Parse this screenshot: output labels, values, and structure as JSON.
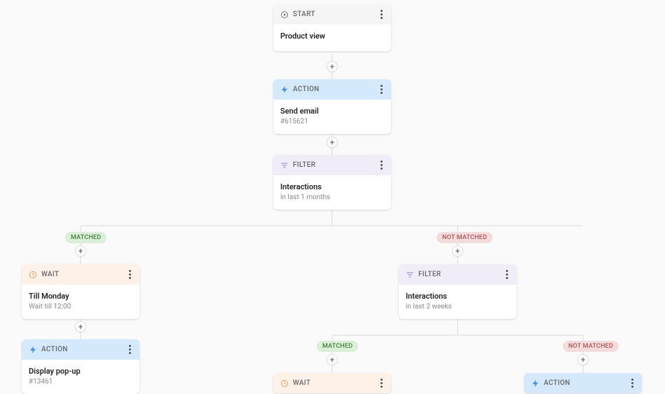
{
  "labels": {
    "start": "START",
    "action": "ACTION",
    "filter": "FILTER",
    "wait": "WAIT",
    "matched": "MATCHED",
    "not_matched": "NOT MATCHED",
    "plus": "+"
  },
  "nodes": {
    "start": {
      "title": "Product view"
    },
    "action1": {
      "title": "Send email",
      "sub": "#615621"
    },
    "filter1": {
      "title": "Interactions",
      "sub": "in last 1 months"
    },
    "wait1": {
      "title": "Till Monday",
      "sub": "Wait till 12:00"
    },
    "action2": {
      "title": "Display pop-up",
      "sub": "#13461"
    },
    "filter2": {
      "title": "Interactions",
      "sub": "in last 2 weeks"
    },
    "wait2": {
      "title": "",
      "sub": ""
    },
    "action3": {
      "title": "",
      "sub": ""
    }
  }
}
